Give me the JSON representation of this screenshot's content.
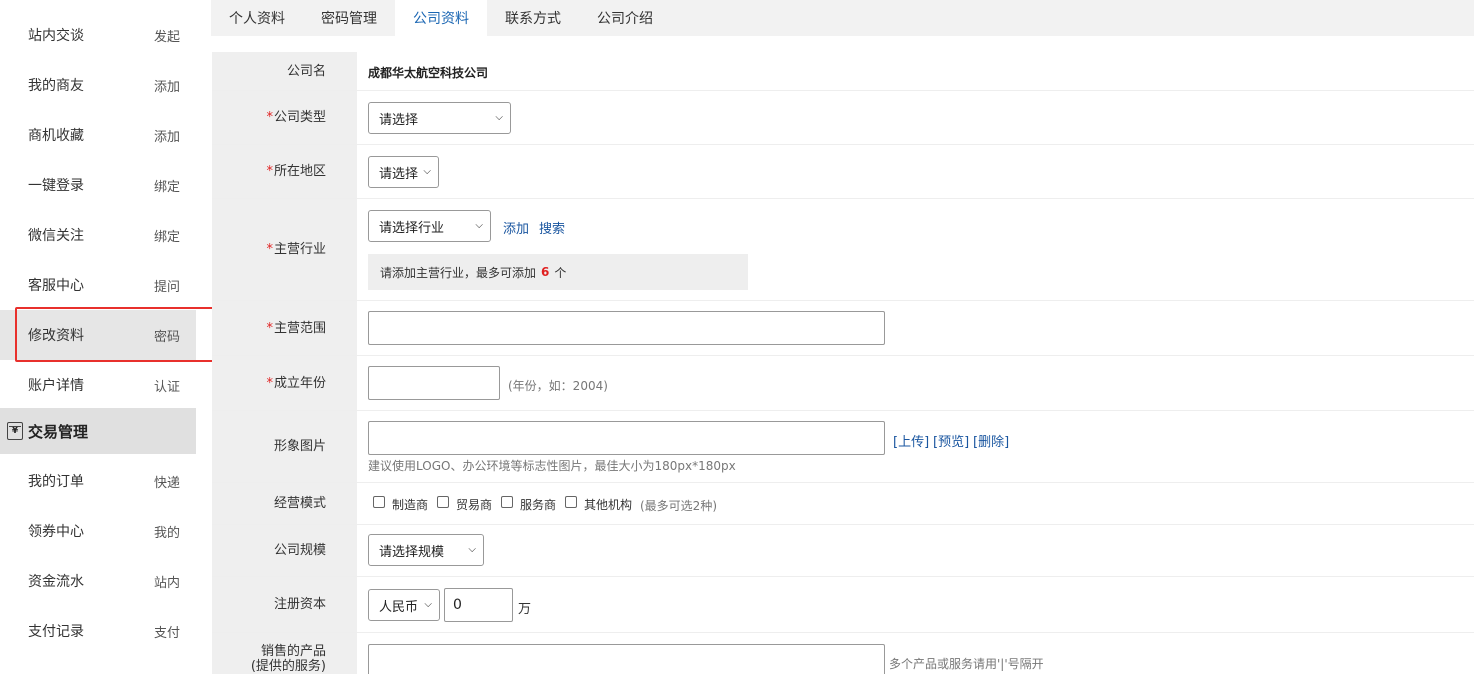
{
  "sidebar": {
    "items": [
      {
        "label": "站内交谈",
        "action": "发起"
      },
      {
        "label": "我的商友",
        "action": "添加"
      },
      {
        "label": "商机收藏",
        "action": "添加"
      },
      {
        "label": "一键登录",
        "action": "绑定"
      },
      {
        "label": "微信关注",
        "action": "绑定"
      },
      {
        "label": "客服中心",
        "action": "提问"
      },
      {
        "label": "修改资料",
        "action": "密码"
      },
      {
        "label": "账户详情",
        "action": "认证"
      }
    ],
    "section": {
      "title": "交易管理",
      "icon": "yen-ledger-icon"
    },
    "section_items": [
      {
        "label": "我的订单",
        "action": "快递"
      },
      {
        "label": "领券中心",
        "action": "我的"
      },
      {
        "label": "资金流水",
        "action": "站内"
      },
      {
        "label": "支付记录",
        "action": "支付"
      }
    ]
  },
  "tabs": [
    "个人资料",
    "密码管理",
    "公司资料",
    "联系方式",
    "公司介绍"
  ],
  "active_tab": "公司资料",
  "form": {
    "company_name": {
      "label": "公司名",
      "value": "成都华太航空科技公司"
    },
    "company_type": {
      "label": "公司类型",
      "value": "请选择"
    },
    "region": {
      "label": "所在地区",
      "value": "请选择"
    },
    "industry": {
      "label": "主营行业",
      "value": "请选择行业",
      "add": "添加",
      "search": "搜索",
      "notice_prefix": "请添加主营行业，最多可添加",
      "notice_count": "6",
      "notice_suffix": "个"
    },
    "scope": {
      "label": "主营范围",
      "value": ""
    },
    "founded": {
      "label": "成立年份",
      "value": "",
      "hint": "(年份，如：2004)"
    },
    "image": {
      "label": "形象图片",
      "value": "",
      "upload": "[上传]",
      "preview": "[预览]",
      "delete": "[删除]",
      "hint": "建议使用LOGO、办公环境等标志性图片，最佳大小为180px*180px"
    },
    "mode": {
      "label": "经营模式",
      "options": [
        "制造商",
        "贸易商",
        "服务商",
        "其他机构"
      ],
      "hint": "(最多可选2种)"
    },
    "size": {
      "label": "公司规模",
      "value": "请选择规模"
    },
    "capital": {
      "label": "注册资本",
      "currency": "人民币",
      "value": "0",
      "unit": "万"
    },
    "products": {
      "label_line1": "销售的产品",
      "label_line2": "(提供的服务)",
      "value": "",
      "hint": "多个产品或服务请用'|'号隔开"
    }
  },
  "required_mark": "*",
  "colors": {
    "accent": "#1a66b3",
    "required": "#e02020",
    "highlight": "#e8302c"
  }
}
